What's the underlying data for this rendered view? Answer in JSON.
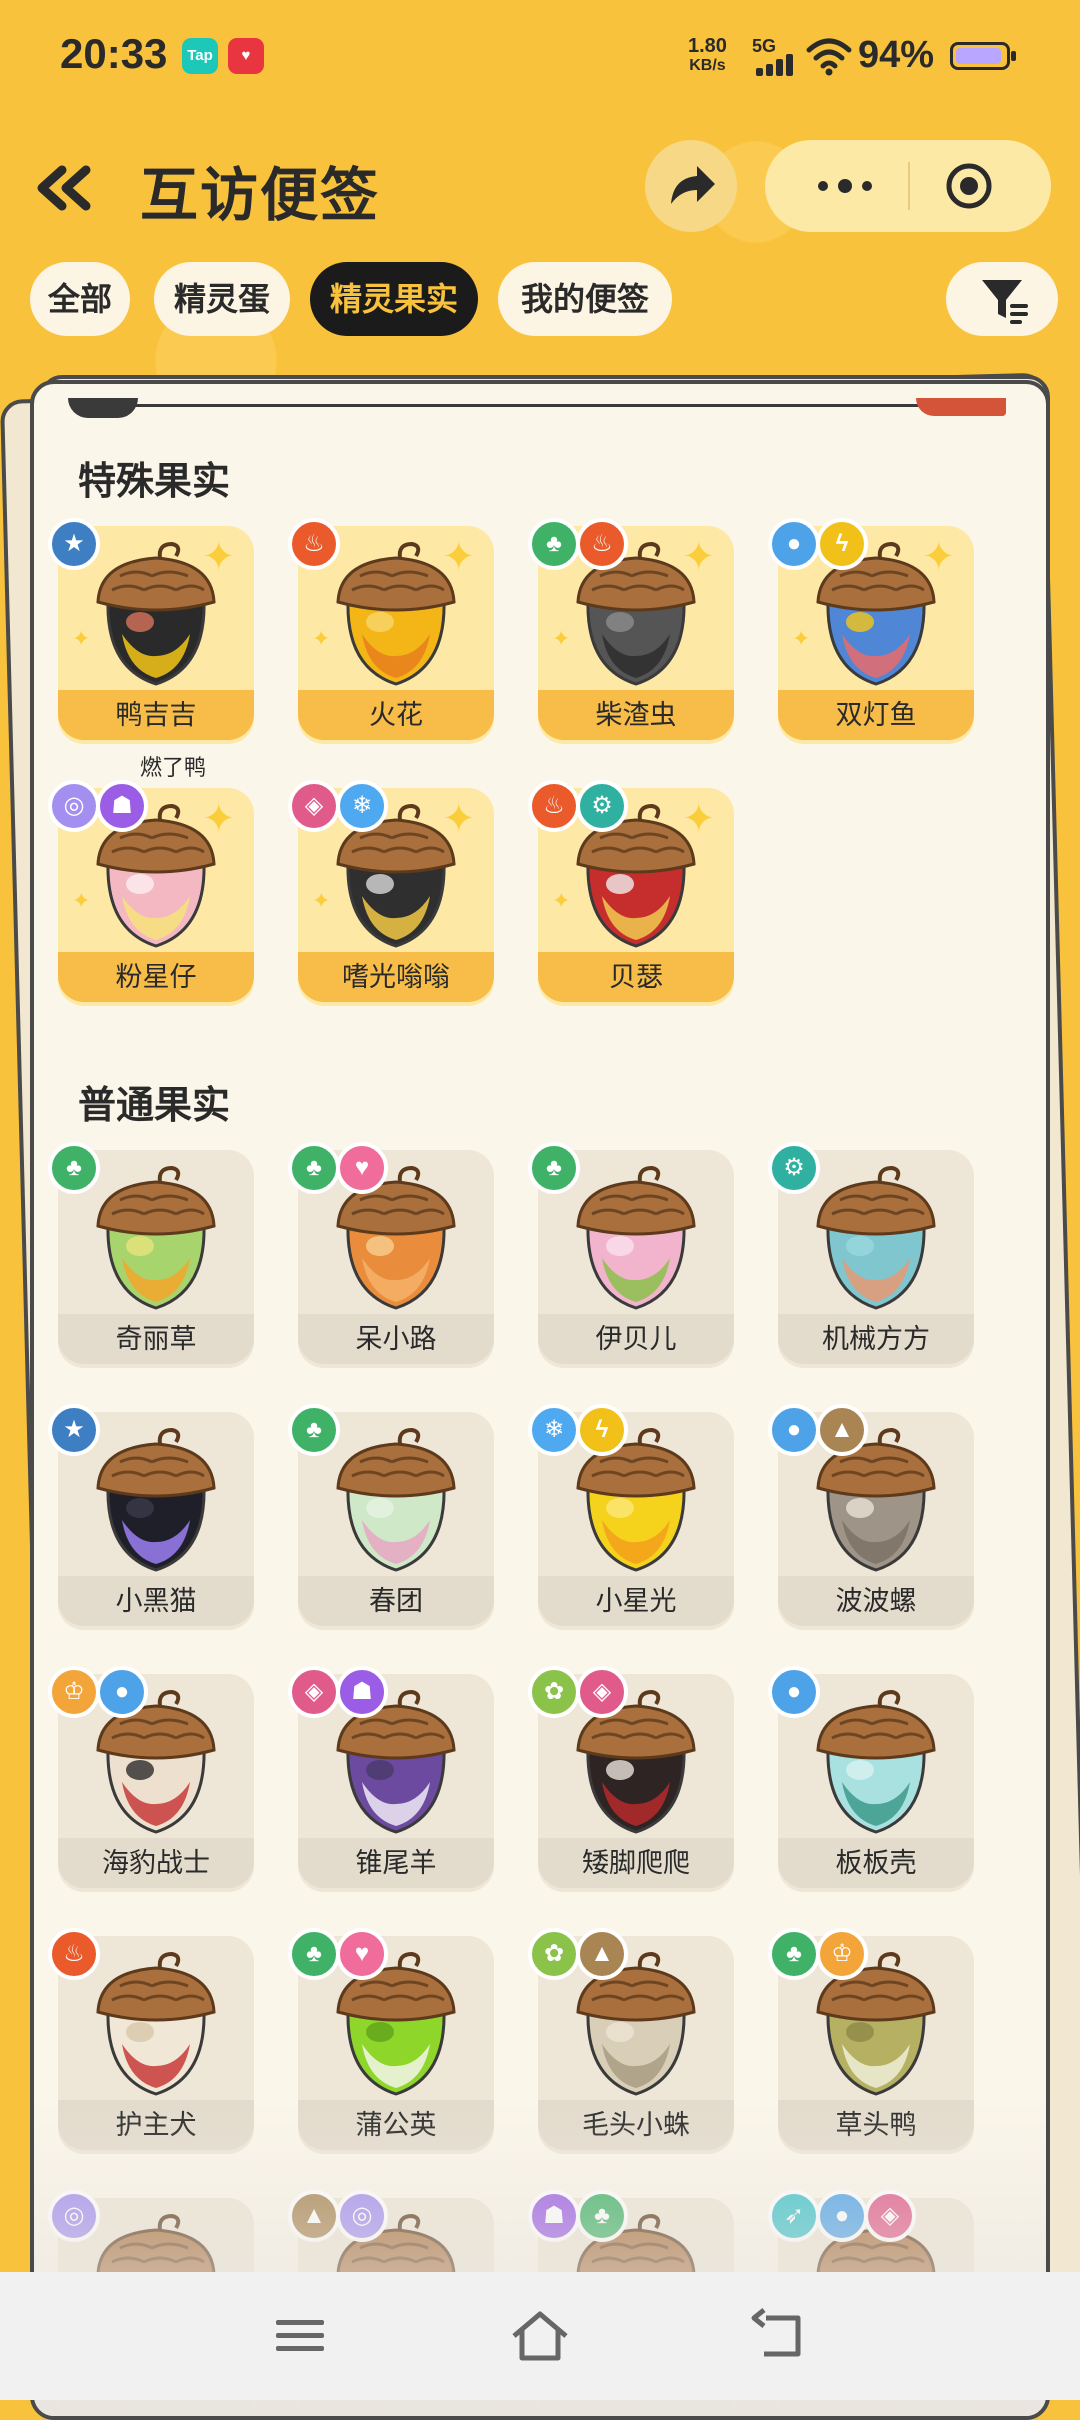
{
  "status_bar": {
    "time": "20:33",
    "app_badges": [
      {
        "label": "Tap",
        "color": "#1ec8b8"
      },
      {
        "label": "♥",
        "color": "#e8353f"
      }
    ],
    "net_speed_value": "1.80",
    "net_speed_unit": "KB/s",
    "signal_label": "5G",
    "battery_percent": "94%",
    "battery_level": 0.94
  },
  "header": {
    "title": "互访便签",
    "back_icon": "double-chevron-left-icon",
    "share_icon": "share-arrow-icon",
    "more_icon": "more-dots-icon",
    "close_icon": "target-circle-icon"
  },
  "tabs": [
    {
      "label": "全部",
      "active": false
    },
    {
      "label": "精灵蛋",
      "active": false
    },
    {
      "label": "精灵果实",
      "active": true
    },
    {
      "label": "我的便签",
      "active": false
    }
  ],
  "filter_icon": "funnel-filter-icon",
  "sections": {
    "special": {
      "title": "特殊果实",
      "items": [
        {
          "name": "鸭吉吉",
          "types": [
            "normal"
          ],
          "colors": [
            "#2a2a2a",
            "#f4c518",
            "#d8735c"
          ]
        },
        {
          "name": "火花",
          "types": [
            "fire"
          ],
          "colors": [
            "#f3b616",
            "#e67f1d",
            "#f8d76e"
          ]
        },
        {
          "name": "柴渣虫",
          "types": [
            "grass",
            "fire"
          ],
          "colors": [
            "#555555",
            "#2e2e2e",
            "#8c8c8c"
          ]
        },
        {
          "name": "双灯鱼",
          "types": [
            "water",
            "electric"
          ],
          "colors": [
            "#4f86d6",
            "#e86b6b",
            "#f4c518"
          ]
        },
        {
          "name": "粉星仔",
          "note": "燃了鸭",
          "types": [
            "psychic",
            "ghost"
          ],
          "colors": [
            "#f4b8c2",
            "#f6e27a",
            "#fbeff0"
          ]
        },
        {
          "name": "嗜光嗡嗡",
          "types": [
            "dark",
            "ice"
          ],
          "colors": [
            "#2f2f2f",
            "#f2c844",
            "#d9d9d9"
          ]
        },
        {
          "name": "贝瑟",
          "types": [
            "fire",
            "mech"
          ],
          "colors": [
            "#c62e2e",
            "#f0c94f",
            "#f0ecec"
          ]
        }
      ]
    },
    "normal": {
      "title": "普通果实",
      "items": [
        {
          "name": "奇丽草",
          "types": [
            "grass"
          ],
          "colors": [
            "#a8d46e",
            "#f4a52a",
            "#e8e27a"
          ]
        },
        {
          "name": "呆小路",
          "types": [
            "grass",
            "cute"
          ],
          "colors": [
            "#e98c3c",
            "#f4b267",
            "#f6cf8e"
          ]
        },
        {
          "name": "伊贝儿",
          "types": [
            "grass"
          ],
          "colors": [
            "#f2b4cc",
            "#8cc04a",
            "#f9e1ec"
          ]
        },
        {
          "name": "机械方方",
          "types": [
            "mech"
          ],
          "colors": [
            "#7fc6cf",
            "#e69a73",
            "#9ad8df"
          ]
        },
        {
          "name": "小黑猫",
          "types": [
            "normal"
          ],
          "colors": [
            "#1f1f2a",
            "#9b7ff2",
            "#3a3a4a"
          ]
        },
        {
          "name": "春团",
          "types": [
            "grass"
          ],
          "colors": [
            "#cfe8c8",
            "#e8a6c2",
            "#e6f2e2"
          ]
        },
        {
          "name": "小星光",
          "types": [
            "ice",
            "electric"
          ],
          "colors": [
            "#f5d21c",
            "#f3a01a",
            "#fbe77b"
          ]
        },
        {
          "name": "波波螺",
          "types": [
            "water",
            "ground"
          ],
          "colors": [
            "#9e9488",
            "#7d7266",
            "#e7e1d5"
          ]
        },
        {
          "name": "海豹战士",
          "types": [
            "fighting",
            "water"
          ],
          "colors": [
            "#eee0cf",
            "#c63a3a",
            "#2a2a2a"
          ]
        },
        {
          "name": "锥尾羊",
          "types": [
            "dark",
            "ghost"
          ],
          "colors": [
            "#6b4aa0",
            "#efe9f6",
            "#4a3a6a"
          ]
        },
        {
          "name": "矮脚爬爬",
          "types": [
            "bug",
            "dark"
          ],
          "colors": [
            "#2f2424",
            "#b52a2a",
            "#eae2da"
          ]
        },
        {
          "name": "板板壳",
          "types": [
            "water"
          ],
          "colors": [
            "#a9e0e0",
            "#3d9a8a",
            "#d8f2f2"
          ]
        },
        {
          "name": "护主犬",
          "types": [
            "fire"
          ],
          "colors": [
            "#f1e7d6",
            "#c83a3a",
            "#d8c7aa"
          ]
        },
        {
          "name": "蒲公英",
          "types": [
            "grass",
            "cute"
          ],
          "colors": [
            "#8fd62a",
            "#f4f4ea",
            "#5fa11a"
          ]
        },
        {
          "name": "毛头小蛛",
          "types": [
            "bug",
            "ground"
          ],
          "colors": [
            "#d9cfb8",
            "#a89c82",
            "#ece5d3"
          ]
        },
        {
          "name": "草头鸭",
          "types": [
            "grass",
            "fighting"
          ],
          "colors": [
            "#b5b062",
            "#eef0d8",
            "#8d8a47"
          ]
        },
        {
          "name": "",
          "types": [
            "psychic"
          ],
          "colors": [
            "#8ec7d8",
            "#e8f0f4",
            "#5aa0b8"
          ]
        },
        {
          "name": "",
          "types": [
            "ground",
            "psychic"
          ],
          "colors": [
            "#f2c94f",
            "#e6e0d0",
            "#c8a63a"
          ]
        },
        {
          "name": "",
          "types": [
            "ghost",
            "grass"
          ],
          "colors": [
            "#7b62d2",
            "#e0daf2",
            "#5a48a8"
          ]
        },
        {
          "name": "",
          "types": [
            "wing",
            "water",
            "dark"
          ],
          "colors": [
            "#4f9bd6",
            "#e0f0f8",
            "#3b78b0"
          ]
        }
      ]
    }
  },
  "type_colors": {
    "normal": "#3d7fc2",
    "fire": "#ea5a2a",
    "grass": "#3fb267",
    "water": "#4ea3e8",
    "electric": "#f1c019",
    "psychic": "#a28ff0",
    "ghost": "#9b5de5",
    "dark": "#e05a8a",
    "ice": "#4fa9f0",
    "mech": "#2fb0a0",
    "cute": "#f06c9a",
    "ground": "#a88552",
    "fighting": "#f3a53a",
    "bug": "#8bc34a",
    "wing": "#3cc3c9"
  },
  "type_glyphs": {
    "normal": "★",
    "fire": "♨",
    "grass": "♣",
    "water": "●",
    "electric": "ϟ",
    "psychic": "◎",
    "ghost": "☗",
    "dark": "◈",
    "ice": "❄",
    "mech": "⚙",
    "cute": "♥",
    "ground": "▲",
    "fighting": "♔",
    "bug": "✿",
    "wing": "➶"
  },
  "nav_bar": {
    "menu_icon": "menu-lines-icon",
    "home_icon": "home-icon",
    "back_icon": "back-arrow-icon"
  }
}
